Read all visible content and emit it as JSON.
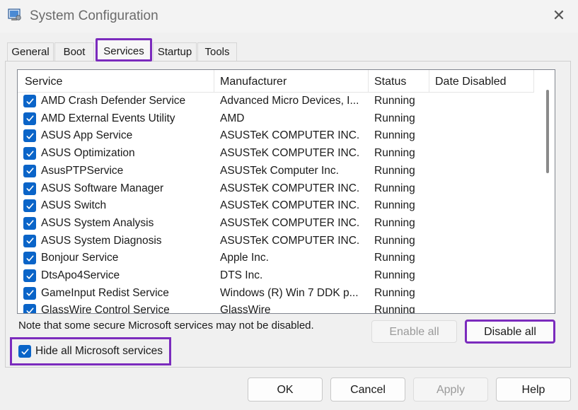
{
  "window": {
    "title": "System Configuration"
  },
  "tabs": [
    {
      "label": "General"
    },
    {
      "label": "Boot"
    },
    {
      "label": "Services"
    },
    {
      "label": "Startup"
    },
    {
      "label": "Tools"
    }
  ],
  "active_tab": "Services",
  "services_table": {
    "columns": [
      "Service",
      "Manufacturer",
      "Status",
      "Date Disabled"
    ],
    "rows": [
      {
        "service": "AMD Crash Defender Service",
        "manufacturer": "Advanced Micro Devices, I...",
        "status": "Running",
        "checked": true
      },
      {
        "service": "AMD External Events Utility",
        "manufacturer": "AMD",
        "status": "Running",
        "checked": true
      },
      {
        "service": "ASUS App Service",
        "manufacturer": "ASUSTeK COMPUTER INC.",
        "status": "Running",
        "checked": true
      },
      {
        "service": "ASUS Optimization",
        "manufacturer": "ASUSTeK COMPUTER INC.",
        "status": "Running",
        "checked": true
      },
      {
        "service": "AsusPTPService",
        "manufacturer": "ASUSTek Computer Inc.",
        "status": "Running",
        "checked": true
      },
      {
        "service": "ASUS Software Manager",
        "manufacturer": "ASUSTeK COMPUTER INC.",
        "status": "Running",
        "checked": true
      },
      {
        "service": "ASUS Switch",
        "manufacturer": "ASUSTeK COMPUTER INC.",
        "status": "Running",
        "checked": true
      },
      {
        "service": "ASUS System Analysis",
        "manufacturer": "ASUSTeK COMPUTER INC.",
        "status": "Running",
        "checked": true
      },
      {
        "service": "ASUS System Diagnosis",
        "manufacturer": "ASUSTeK COMPUTER INC.",
        "status": "Running",
        "checked": true
      },
      {
        "service": "Bonjour Service",
        "manufacturer": "Apple Inc.",
        "status": "Running",
        "checked": true
      },
      {
        "service": "DtsApo4Service",
        "manufacturer": "DTS Inc.",
        "status": "Running",
        "checked": true
      },
      {
        "service": "GameInput Redist Service",
        "manufacturer": "Windows (R) Win 7 DDK p...",
        "status": "Running",
        "checked": true
      },
      {
        "service": "GlassWire Control Service",
        "manufacturer": "GlassWire",
        "status": "Running",
        "checked": true
      }
    ]
  },
  "note": "Note that some secure Microsoft services may not be disabled.",
  "buttons": {
    "enable_all": "Enable all",
    "disable_all": "Disable all",
    "ok": "OK",
    "cancel": "Cancel",
    "apply": "Apply",
    "help": "Help"
  },
  "hide_microsoft": {
    "label": "Hide all Microsoft services",
    "checked": true
  },
  "colors": {
    "accent": "#0a64c8",
    "highlight": "#7b2bbd"
  }
}
